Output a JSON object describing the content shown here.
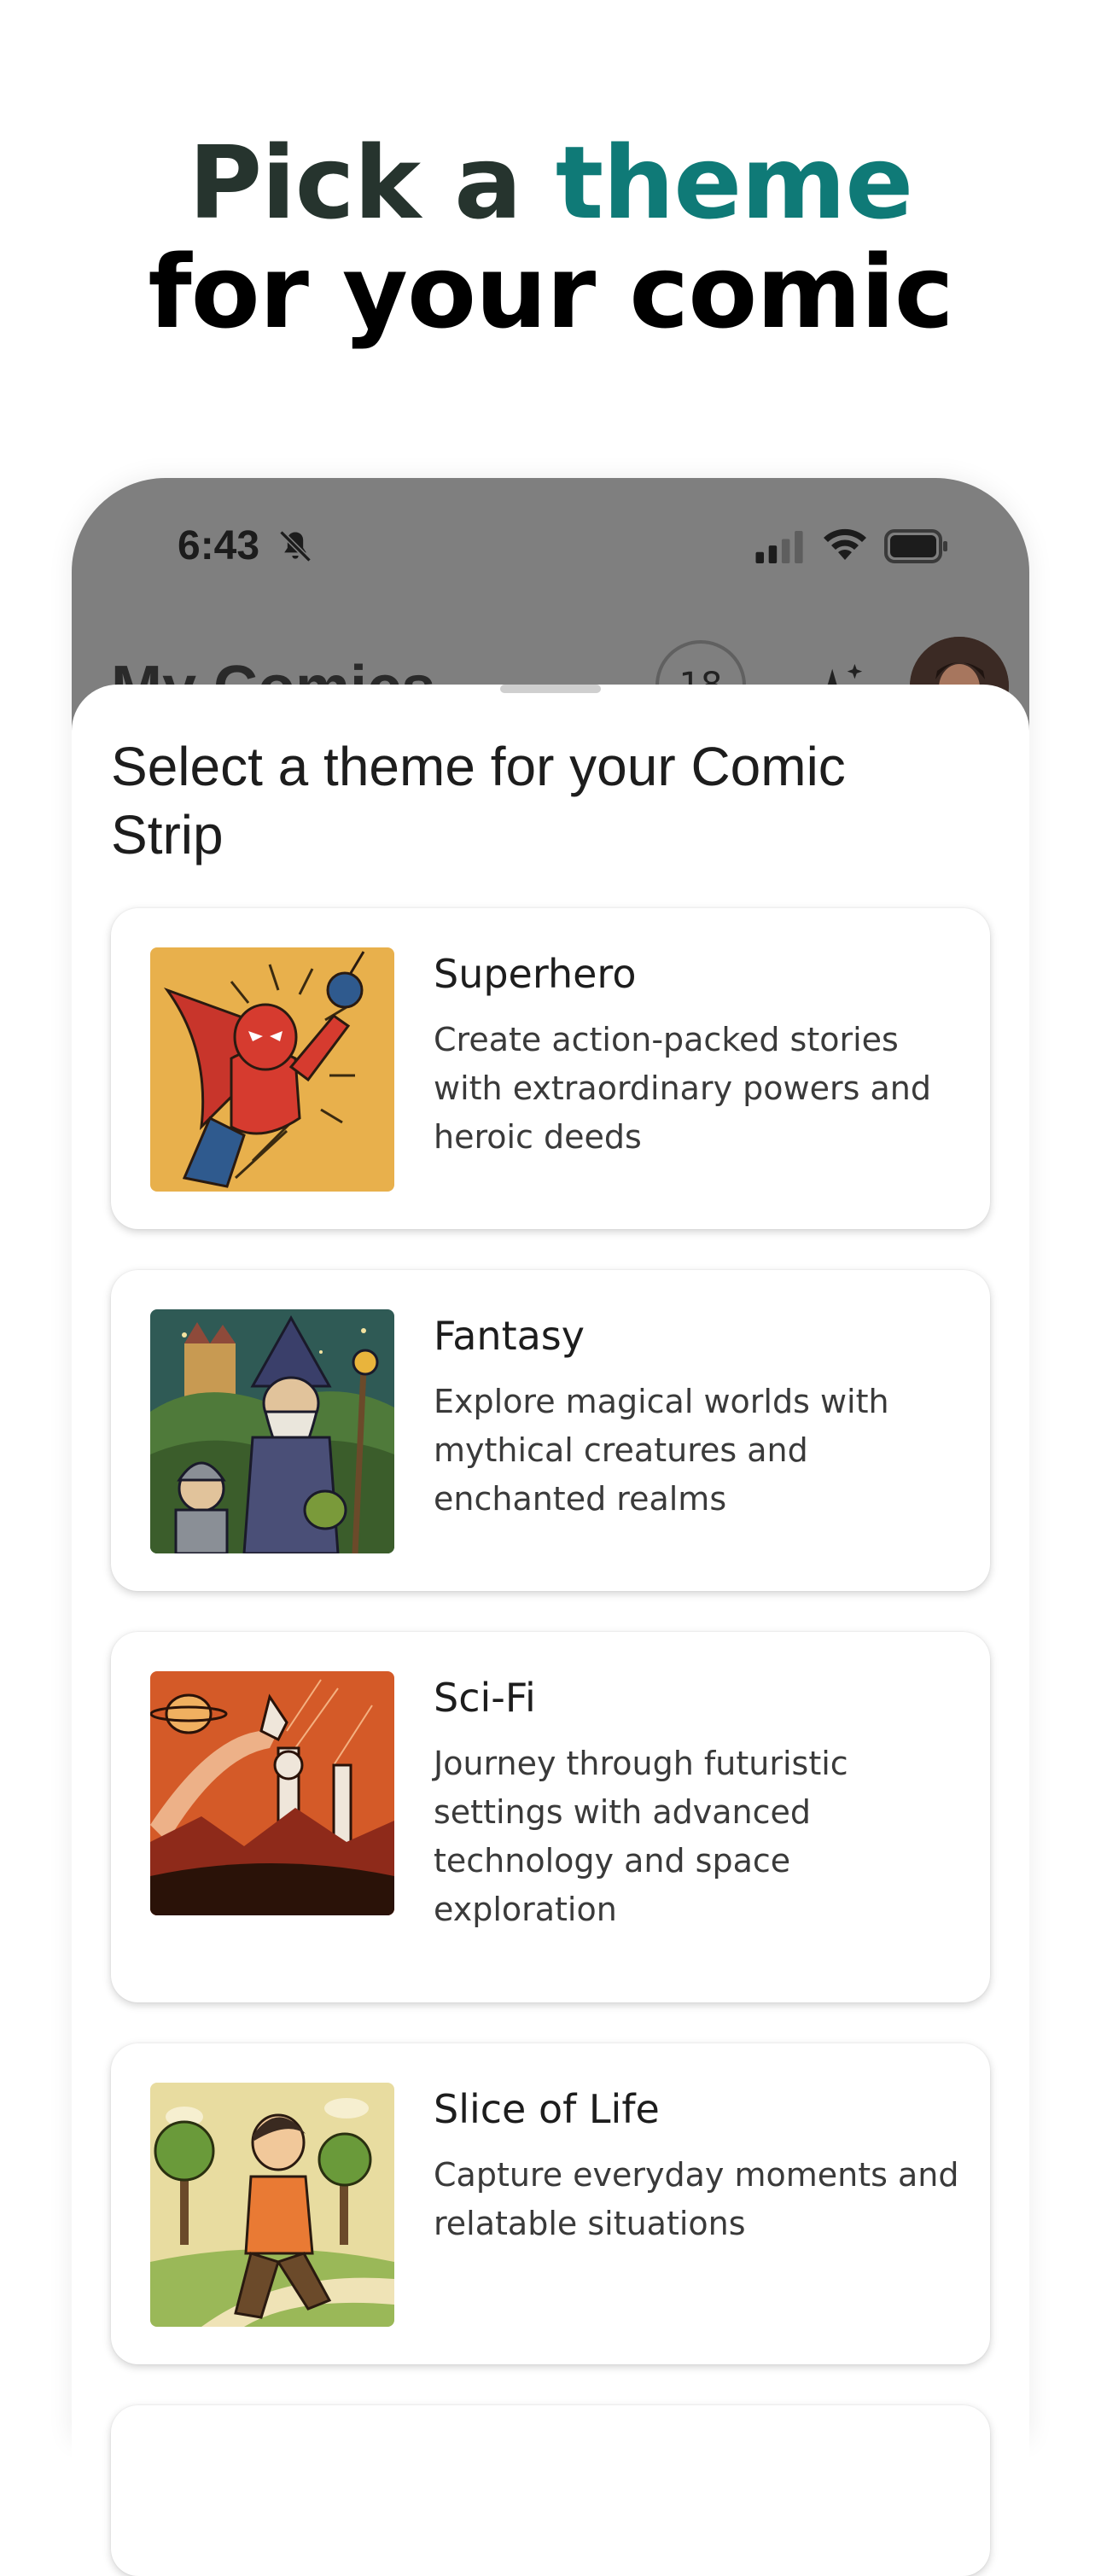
{
  "headline": {
    "pre": "Pick a ",
    "accent": "theme",
    "line2": "for your comic"
  },
  "status_bar": {
    "time": "6:43"
  },
  "app_bar": {
    "title": "My Comics",
    "credits": "18"
  },
  "sheet": {
    "title": "Select a theme for your Comic Strip",
    "themes": [
      {
        "title": "Superhero",
        "description": "Create action-packed stories with extraordinary powers and heroic deeds"
      },
      {
        "title": "Fantasy",
        "description": "Explore magical worlds with mythical creatures and enchanted realms"
      },
      {
        "title": "Sci-Fi",
        "description": "Journey through futuristic settings with advanced technology and space exploration"
      },
      {
        "title": "Slice of Life",
        "description": "Capture everyday moments and relatable situations"
      }
    ]
  },
  "colors": {
    "accent": "#0f7a77",
    "headline_dark": "#26342e",
    "scrim": "#7f7f7f"
  },
  "icons": [
    "bell-slash-icon",
    "cellular-signal-icon",
    "wifi-icon",
    "battery-icon",
    "sparkle-icon"
  ]
}
